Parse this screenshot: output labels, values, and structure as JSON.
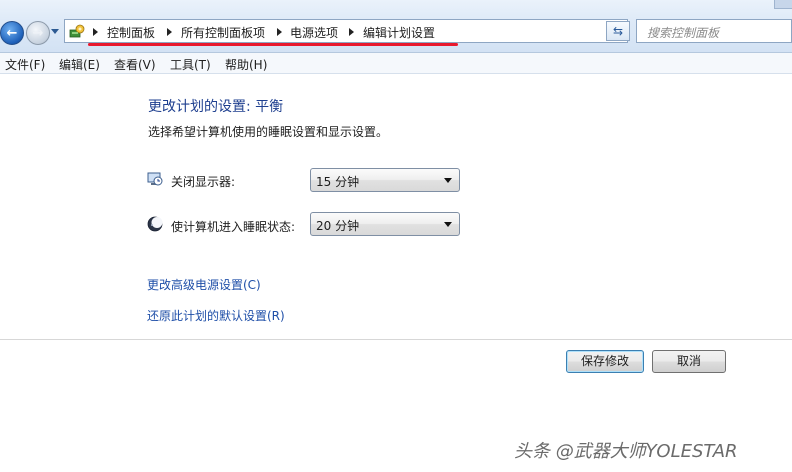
{
  "address_bar": {
    "breadcrumbs": [
      "控制面板",
      "所有控制面板项",
      "电源选项",
      "编辑计划设置"
    ],
    "search_placeholder": "搜索控制面板",
    "refresh_glyph": "⇆"
  },
  "menu": {
    "items": [
      "文件(F)",
      "编辑(E)",
      "查看(V)",
      "工具(T)",
      "帮助(H)"
    ]
  },
  "plan": {
    "title": "更改计划的设置: 平衡",
    "description": "选择希望计算机使用的睡眠设置和显示设置。",
    "settings": [
      {
        "label": "关闭显示器:",
        "value": "15 分钟",
        "icon": "monitor-clock-icon"
      },
      {
        "label": "使计算机进入睡眠状态:",
        "value": "20 分钟",
        "icon": "moon-sleep-icon"
      }
    ]
  },
  "links": {
    "advanced": "更改高级电源设置(C)",
    "restore": "还原此计划的默认设置(R)"
  },
  "buttons": {
    "save": "保存修改",
    "cancel": "取消"
  },
  "watermark": "头条 @武器大师YOLESTAR",
  "colors": {
    "title_blue": "#1e3f8f",
    "link_blue": "#1f4fa8",
    "underline_red": "#e8182d"
  }
}
